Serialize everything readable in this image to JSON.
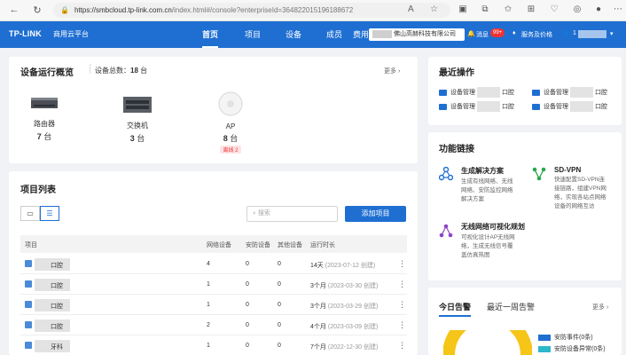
{
  "browser": {
    "url_host": "https://smbcloud.tp-link.com.cn",
    "url_path": "/index.html#/console?enterpriseId=364822015196188672"
  },
  "header": {
    "logo": "TP-LINK",
    "platform": "商用云平台",
    "nav": [
      "首页",
      "项目",
      "设备",
      "成员",
      "费用"
    ],
    "company": "佛山高赫科技有限公司",
    "messages": "消息",
    "messages_badge": "99+",
    "service": "服务及价格",
    "user": "1"
  },
  "overview": {
    "title": "设备运行概览",
    "total_label": "设备总数：",
    "total_value": "18",
    "total_unit": "台",
    "more": "更多",
    "devices": [
      {
        "name": "路由器",
        "count": "7",
        "unit": "台",
        "icon": "router-icon"
      },
      {
        "name": "交换机",
        "count": "3",
        "unit": "台",
        "icon": "switch-icon"
      },
      {
        "name": "AP",
        "count": "8",
        "unit": "台",
        "icon": "ap-icon",
        "offline": "离线 2"
      }
    ]
  },
  "projects": {
    "title": "项目列表",
    "search_placeholder": "搜索",
    "add_label": "添加项目",
    "columns": [
      "项目",
      "网络设备",
      "安防设备",
      "其他设备",
      "运行时长"
    ],
    "rows": [
      {
        "name": "口腔",
        "net": "4",
        "sec": "0",
        "other": "0",
        "runtime": "14天",
        "created": "(2023-07-12 创建)"
      },
      {
        "name": "口腔",
        "net": "1",
        "sec": "0",
        "other": "0",
        "runtime": "3个月",
        "created": "(2023-03-30 创建)"
      },
      {
        "name": "口腔",
        "net": "1",
        "sec": "0",
        "other": "0",
        "runtime": "3个月",
        "created": "(2023-03-29 创建)"
      },
      {
        "name": "口腔",
        "net": "2",
        "sec": "0",
        "other": "0",
        "runtime": "4个月",
        "created": "(2023-03-09 创建)"
      },
      {
        "name": "牙科",
        "net": "1",
        "sec": "0",
        "other": "0",
        "runtime": "7个月",
        "created": "(2022-12-30 创建)"
      }
    ]
  },
  "recent": {
    "title": "最近操作",
    "items": [
      {
        "prefix": "设备管理",
        "suffix": "口腔"
      },
      {
        "prefix": "设备管理",
        "suffix": "口腔"
      },
      {
        "prefix": "设备管理",
        "suffix": "口腔"
      },
      {
        "prefix": "设备管理",
        "suffix": "口腔"
      }
    ]
  },
  "features": {
    "title": "功能链接",
    "items": [
      {
        "title": "生成解决方案",
        "desc": [
          "生成有线网络、无线",
          "网络、安防监控网络",
          "解决方案"
        ],
        "icon": "solution-icon"
      },
      {
        "title": "SD-VPN",
        "desc": [
          "快速配置SD-VPN连",
          "接链路，组建VPN网",
          "络，实现各站点网络",
          "设备的网络互访"
        ],
        "icon": "vpn-icon"
      },
      {
        "title": "无线网络可视化规划",
        "desc": [
          "可视化设计AP无线网",
          "络，生成无线信号覆",
          "盖仿真热图"
        ],
        "icon": "wireless-plan-icon"
      }
    ]
  },
  "alerts": {
    "tabs": [
      "今日告警",
      "最近一周告警"
    ],
    "more": "更多",
    "legend": [
      {
        "label": "安防事件(0条)",
        "color": "#1f6fd2"
      },
      {
        "label": "安防设备异常(0条)",
        "color": "#2db7c9"
      }
    ]
  }
}
